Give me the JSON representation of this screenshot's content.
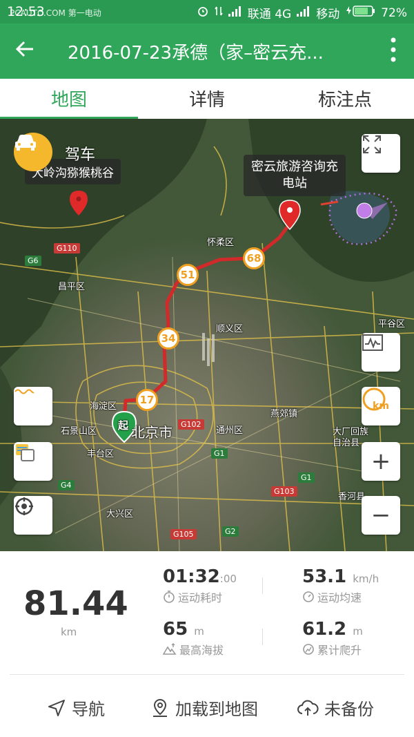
{
  "status": {
    "time": "12:53",
    "watermark": "PCAUTO.COM 第一电动",
    "carrier1": "联通 4G",
    "carrier2": "移动",
    "battery": "72%"
  },
  "appbar": {
    "back_icon": "arrow-left-icon",
    "title": "2016-07-23承德（家–密云充...",
    "more_icon": "more-vertical-icon"
  },
  "tabs": [
    {
      "label": "地图",
      "active": true
    },
    {
      "label": "详情",
      "active": false
    },
    {
      "label": "标注点",
      "active": false
    }
  ],
  "map": {
    "mode_label": "驾车",
    "poi_label": "大岭沟猕猴桃谷",
    "end_popup_line1": "密云旅游咨询充",
    "end_popup_line2": "电站",
    "start_marker": "起",
    "km_markers": [
      "17",
      "34",
      "51",
      "68"
    ],
    "places": {
      "huairou": "怀柔区",
      "changping": "昌平区",
      "shunyi": "顺义区",
      "pinggu": "平谷区",
      "haidian": "海淀区",
      "beijing": "北京市",
      "shijingshan": "石景山区",
      "fengtai": "丰台区",
      "tongzhou": "通州区",
      "yanjiao": "燕郊镇",
      "dachang": "大厂回族自治县",
      "daxing": "大兴区",
      "xianghe": "香河县"
    },
    "roads": [
      "G110",
      "G6",
      "G102",
      "G1",
      "G4",
      "G103",
      "G105",
      "G2",
      "G1"
    ],
    "controls": {
      "fullscreen_icon": "fullscreen-icon",
      "chart_icon": "elevation-chart-icon",
      "km_label": "km",
      "zoom_in": "+",
      "zoom_out": "−"
    }
  },
  "stats": {
    "distance": "81.44",
    "distance_unit": "km",
    "duration": "01:32",
    "duration_sec": ":00",
    "duration_label": "运动耗时",
    "avg_speed": "53.1",
    "avg_speed_unit": "km/h",
    "avg_speed_label": "运动均速",
    "max_alt": "65",
    "max_alt_unit": "m",
    "max_alt_label": "最高海拔",
    "climb": "61.2",
    "climb_unit": "m",
    "climb_label": "累计爬升"
  },
  "actions": [
    {
      "label": "导航",
      "icon": "navigation-arrow-icon"
    },
    {
      "label": "加载到地图",
      "icon": "map-pin-icon"
    },
    {
      "label": "未备份",
      "icon": "cloud-upload-icon"
    }
  ],
  "colors": {
    "brand": "#2fa65a",
    "route": "#d02a2a",
    "km_marker": "#f0a020"
  }
}
